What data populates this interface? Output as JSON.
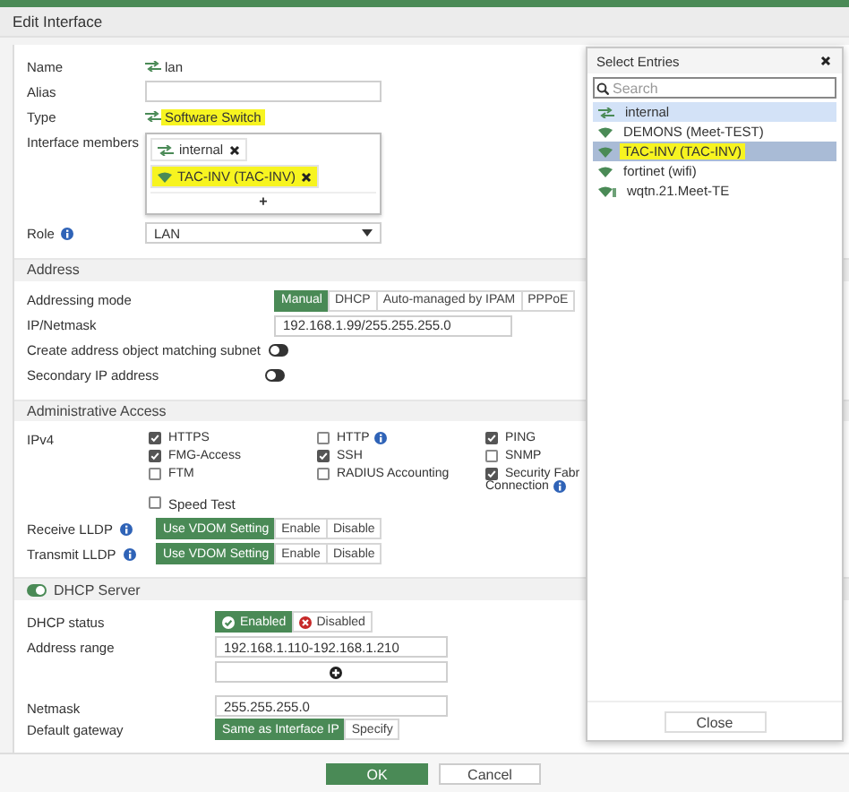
{
  "title": "Edit Interface",
  "general": {
    "name_label": "Name",
    "name": "lan",
    "alias_label": "Alias",
    "type_label": "Type",
    "type": "Software Switch",
    "type_highlighted": true,
    "members_label": "Interface members",
    "members": [
      {
        "label": "internal",
        "kind": "switch",
        "highlighted": false
      },
      {
        "label": "TAC-INV (TAC-INV)",
        "kind": "wifi",
        "highlighted": true
      }
    ],
    "add": "+",
    "role_label": "Role",
    "role": "LAN"
  },
  "address": {
    "title": "Address",
    "mode_label": "Addressing mode",
    "modes": [
      {
        "label": "Manual",
        "selected": true
      },
      {
        "label": "DHCP",
        "selected": false
      },
      {
        "label": "Auto-managed by IPAM",
        "selected": false
      },
      {
        "label": "PPPoE",
        "selected": false
      }
    ],
    "ip_label": "IP/Netmask",
    "ip": "192.168.1.99/255.255.255.0",
    "create_label": "Create address object matching subnet",
    "create_on": false,
    "secondary_label": "Secondary IP address",
    "secondary_on": false
  },
  "admin": {
    "title": "Administrative Access",
    "ipv4_label": "IPv4",
    "options": [
      {
        "label": "HTTPS",
        "checked": true,
        "info": false
      },
      {
        "label": "HTTP",
        "checked": false,
        "info": true
      },
      {
        "label": "PING",
        "checked": true,
        "info": false
      },
      {
        "label": "FMG-Access",
        "checked": true,
        "info": false
      },
      {
        "label": "SSH",
        "checked": true,
        "info": false
      },
      {
        "label": "SNMP",
        "checked": false,
        "info": false
      },
      {
        "label": "FTM",
        "checked": false,
        "info": false
      },
      {
        "label": "RADIUS Accounting",
        "checked": false,
        "info": false
      },
      {
        "label": "Security Fabr",
        "continuation": "Connection",
        "checked": true,
        "info": true
      }
    ],
    "speed_test": {
      "label": "Speed Test",
      "checked": false
    },
    "lldp": [
      {
        "label": "Receive LLDP",
        "options": [
          {
            "label": "Use VDOM Setting",
            "selected": true
          },
          {
            "label": "Enable",
            "selected": false
          },
          {
            "label": "Disable",
            "selected": false
          }
        ]
      },
      {
        "label": "Transmit LLDP",
        "options": [
          {
            "label": "Use VDOM Setting",
            "selected": true
          },
          {
            "label": "Enable",
            "selected": false
          },
          {
            "label": "Disable",
            "selected": false
          }
        ]
      }
    ]
  },
  "dhcp": {
    "title": "DHCP Server",
    "on": true,
    "status_label": "DHCP status",
    "statuses": [
      {
        "label": "Enabled",
        "kind": "enabled",
        "selected": true
      },
      {
        "label": "Disabled",
        "kind": "disabled",
        "selected": false
      }
    ],
    "range_label": "Address range",
    "range": "192.168.1.110-192.168.1.210",
    "netmask_label": "Netmask",
    "netmask": "255.255.255.0",
    "gateway_label": "Default gateway",
    "gateway_options": [
      {
        "label": "Same as Interface IP",
        "selected": true
      },
      {
        "label": "Specify",
        "selected": false
      }
    ]
  },
  "popup": {
    "title": "Select Entries",
    "search_placeholder": "Search",
    "entries": [
      {
        "label": "internal",
        "kind": "switch",
        "selected": true,
        "focused": false,
        "highlighted": false
      },
      {
        "label": "DEMONS (Meet-TEST)",
        "kind": "wifi",
        "selected": false,
        "focused": false,
        "highlighted": false
      },
      {
        "label": "TAC-INV (TAC-INV)",
        "kind": "wifi",
        "selected": true,
        "focused": true,
        "highlighted": true
      },
      {
        "label": "fortinet (wifi)",
        "kind": "wifi",
        "selected": false,
        "focused": false,
        "highlighted": false
      },
      {
        "label": "wqtn.21.Meet-TE",
        "kind": "mesh",
        "selected": false,
        "focused": false,
        "highlighted": false
      }
    ],
    "close": "Close"
  },
  "buttons": [
    {
      "label": "OK",
      "kind": "primary"
    },
    {
      "label": "Cancel",
      "kind": "secondary"
    }
  ]
}
